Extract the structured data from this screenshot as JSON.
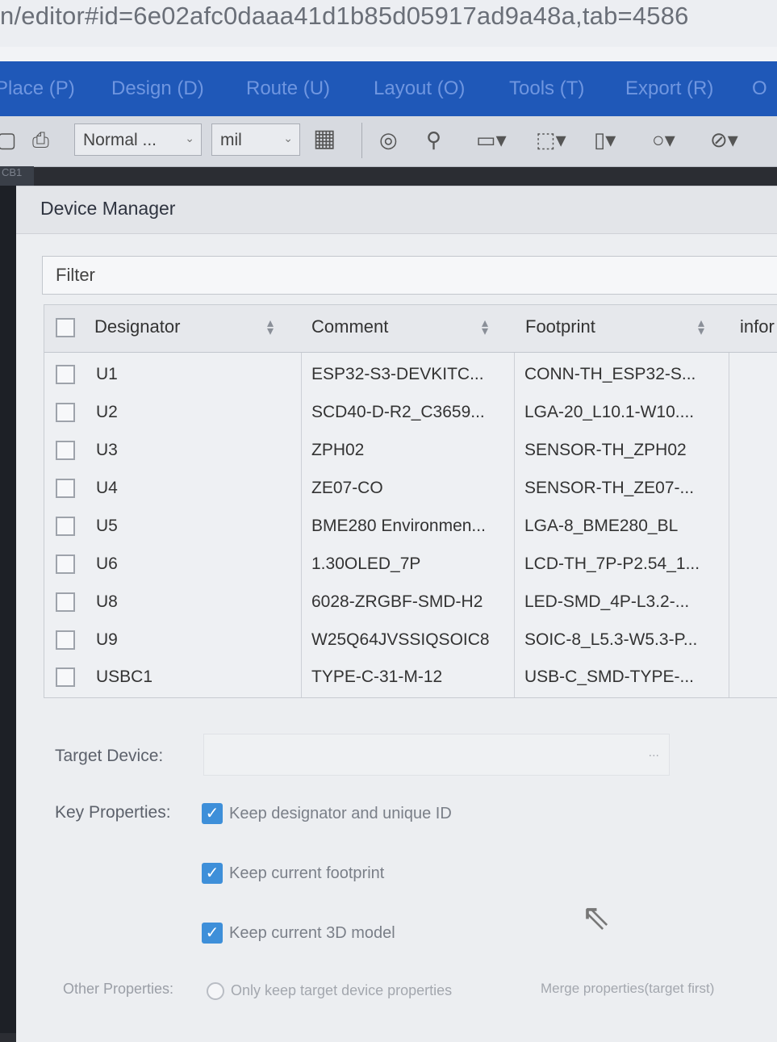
{
  "browser": {
    "url": "n/editor#id=6e02afc0daaa41d1b85d05917ad9a48a,tab=4586"
  },
  "menu": [
    {
      "label": "Place (P)"
    },
    {
      "label": "Design (D)"
    },
    {
      "label": "Route (U)"
    },
    {
      "label": "Layout (O)"
    },
    {
      "label": "Tools (T)"
    },
    {
      "label": "Export (R)"
    },
    {
      "label": "O"
    }
  ],
  "toolbar": {
    "mode_select": "Normal ...",
    "unit_select": "mil",
    "icons": [
      "layer-icon",
      "print-icon",
      "grid-icon",
      "via-icon",
      "pin-icon",
      "rect-icon",
      "poly-icon",
      "region-icon",
      "circle-icon",
      "no-entry-icon"
    ]
  },
  "left_tab": {
    "label": "CB1"
  },
  "dialog": {
    "title": "Device Manager",
    "filter_placeholder": "Filter",
    "columns": {
      "designator": "Designator",
      "comment": "Comment",
      "footprint": "Footprint",
      "info": "infor"
    },
    "rows": [
      {
        "designator": "U1",
        "comment": "ESP32-S3-DEVKITC...",
        "footprint": "CONN-TH_ESP32-S..."
      },
      {
        "designator": "U2",
        "comment": "SCD40-D-R2_C3659...",
        "footprint": "LGA-20_L10.1-W10...."
      },
      {
        "designator": "U3",
        "comment": "ZPH02",
        "footprint": "SENSOR-TH_ZPH02"
      },
      {
        "designator": "U4",
        "comment": "ZE07-CO",
        "footprint": "SENSOR-TH_ZE07-..."
      },
      {
        "designator": "U5",
        "comment": "BME280 Environmen...",
        "footprint": "LGA-8_BME280_BL"
      },
      {
        "designator": "U6",
        "comment": "1.30OLED_7P",
        "footprint": "LCD-TH_7P-P2.54_1..."
      },
      {
        "designator": "U8",
        "comment": "6028-ZRGBF-SMD-H2",
        "footprint": "LED-SMD_4P-L3.2-..."
      },
      {
        "designator": "U9",
        "comment": "W25Q64JVSSIQSOIC8",
        "footprint": "SOIC-8_L5.3-W5.3-P..."
      },
      {
        "designator": "USBC1",
        "comment": "TYPE-C-31-M-12",
        "footprint": "USB-C_SMD-TYPE-..."
      }
    ],
    "target_device_label": "Target Device:",
    "target_device_button": "...",
    "key_properties_label": "Key Properties:",
    "key_options": [
      {
        "label": "Keep designator and unique ID",
        "checked": true
      },
      {
        "label": "Keep current footprint",
        "checked": true
      },
      {
        "label": "Keep current 3D model",
        "checked": true
      }
    ],
    "other_properties_label": "Other Properties:",
    "other_options": [
      {
        "label": "Only keep target device properties"
      },
      {
        "label": "Merge properties(target first)"
      }
    ]
  },
  "colors": {
    "menubar": "#1f58b8",
    "checkbox_checked": "#3e8fd9",
    "dialog_bg": "#eceef1"
  }
}
